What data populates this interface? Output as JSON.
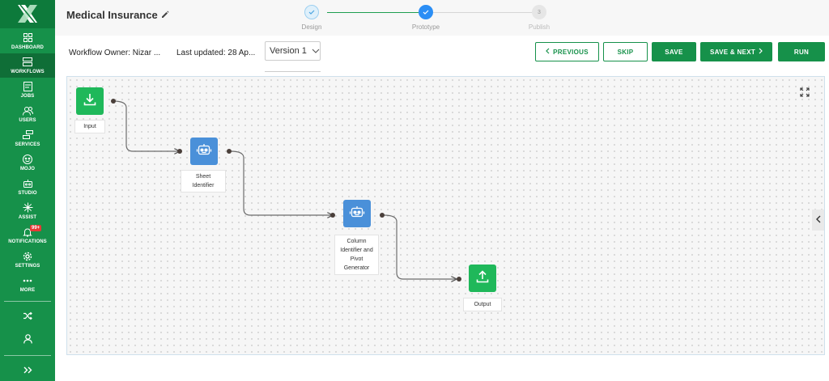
{
  "sidebar": {
    "items": [
      {
        "label": "DASHBOARD",
        "icon": "dashboard-icon"
      },
      {
        "label": "WORKFLOWS",
        "icon": "workflows-icon"
      },
      {
        "label": "JOBS",
        "icon": "jobs-icon"
      },
      {
        "label": "USERS",
        "icon": "users-icon"
      },
      {
        "label": "SERVICES",
        "icon": "services-icon"
      },
      {
        "label": "MOJO",
        "icon": "mojo-icon"
      },
      {
        "label": "STUDIO",
        "icon": "studio-icon"
      },
      {
        "label": "ASSIST",
        "icon": "assist-icon"
      },
      {
        "label": "NOTIFICATIONS",
        "icon": "bell-icon"
      },
      {
        "label": "SETTINGS",
        "icon": "gear-icon"
      },
      {
        "label": "MORE",
        "icon": "more-icon"
      }
    ],
    "notification_badge": "99+",
    "active_item": "WORKFLOWS"
  },
  "header": {
    "title": "Medical Insurance",
    "steps": [
      {
        "label": "Design",
        "state": "done",
        "number": ""
      },
      {
        "label": "Prototype",
        "state": "current",
        "number": ""
      },
      {
        "label": "Publish",
        "state": "pending",
        "number": "3"
      }
    ]
  },
  "toolbar": {
    "owner": "Workflow Owner: Nizar ...",
    "updated": "Last updated: 28 Ap...",
    "version": "Version 1",
    "previous_label": "PREVIOUS",
    "skip_label": "SKIP",
    "save_label": "SAVE",
    "save_next_label": "SAVE & NEXT",
    "run_label": "RUN"
  },
  "canvas": {
    "nodes": {
      "input": "Input",
      "sheet_identifier": "Sheet Identifier",
      "column_identifier": "Column Identifier and Pivot Generator",
      "output": "Output"
    }
  },
  "colors": {
    "brand_green": "#16914a",
    "node_green": "#1fb85a",
    "node_blue": "#4a90d9",
    "step_blue": "#2b8ef5"
  }
}
